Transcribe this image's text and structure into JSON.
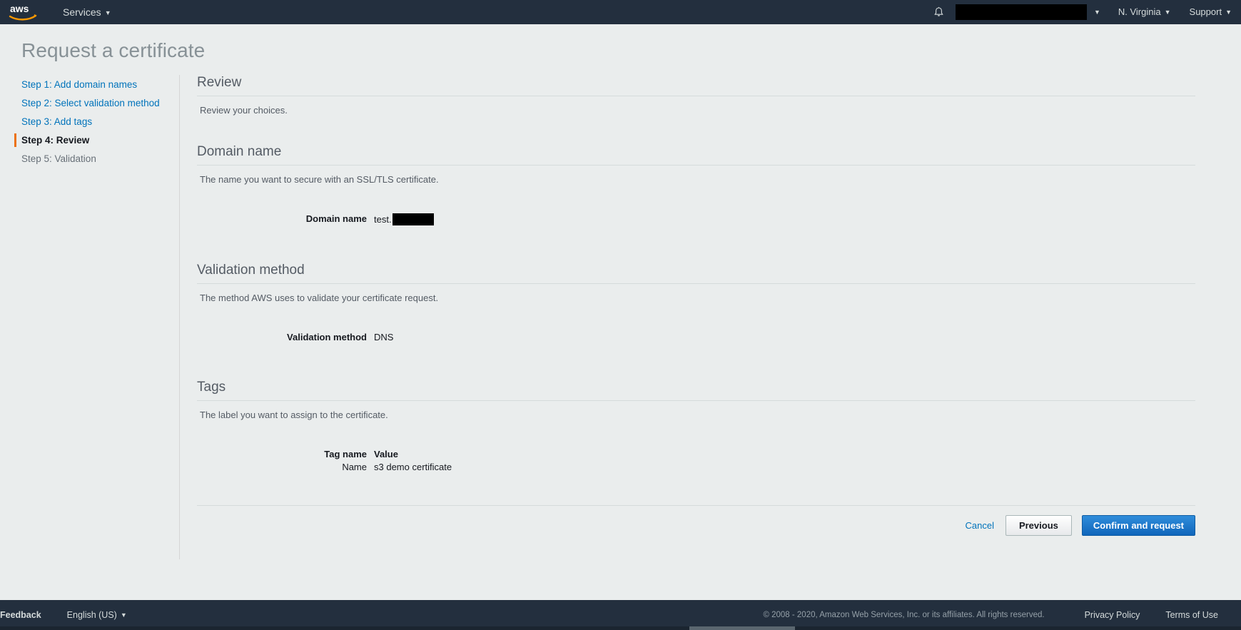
{
  "topnav": {
    "logo_alt": "aws",
    "services_label": "Services",
    "bell_icon": "bell-icon",
    "account_redacted": "",
    "region_label": "N. Virginia",
    "support_label": "Support",
    "caret": "▼"
  },
  "page": {
    "title": "Request a certificate"
  },
  "sidebar": {
    "items": [
      {
        "label": "Step 1: Add domain names",
        "state": "link"
      },
      {
        "label": "Step 2: Select validation method",
        "state": "link"
      },
      {
        "label": "Step 3: Add tags",
        "state": "link"
      },
      {
        "label": "Step 4: Review",
        "state": "active"
      },
      {
        "label": "Step 5: Validation",
        "state": "future"
      }
    ]
  },
  "main": {
    "review": {
      "title": "Review",
      "description": "Review your choices."
    },
    "domain": {
      "title": "Domain name",
      "description": "The name you want to secure with an SSL/TLS certificate.",
      "label": "Domain name",
      "value_prefix": "test.",
      "value_redacted": ""
    },
    "validation": {
      "title": "Validation method",
      "description": "The method AWS uses to validate your certificate request.",
      "label": "Validation method",
      "value": "DNS"
    },
    "tags": {
      "title": "Tags",
      "description": "The label you want to assign to the certificate.",
      "columns": [
        "Tag name",
        "Value"
      ],
      "rows": [
        {
          "name": "Name",
          "value": "s3 demo certificate"
        }
      ]
    }
  },
  "actions": {
    "cancel_label": "Cancel",
    "previous_label": "Previous",
    "confirm_label": "Confirm and request"
  },
  "footer": {
    "feedback_label": "Feedback",
    "language_label": "English (US)",
    "copyright": "© 2008 - 2020, Amazon Web Services, Inc. or its affiliates. All rights reserved.",
    "privacy_label": "Privacy Policy",
    "terms_label": "Terms of Use"
  },
  "colors": {
    "nav_bg": "#232f3e",
    "page_bg": "#eaeded",
    "link": "#0073bb",
    "accent_orange": "#ec7211",
    "primary_button": "#1066bb"
  }
}
